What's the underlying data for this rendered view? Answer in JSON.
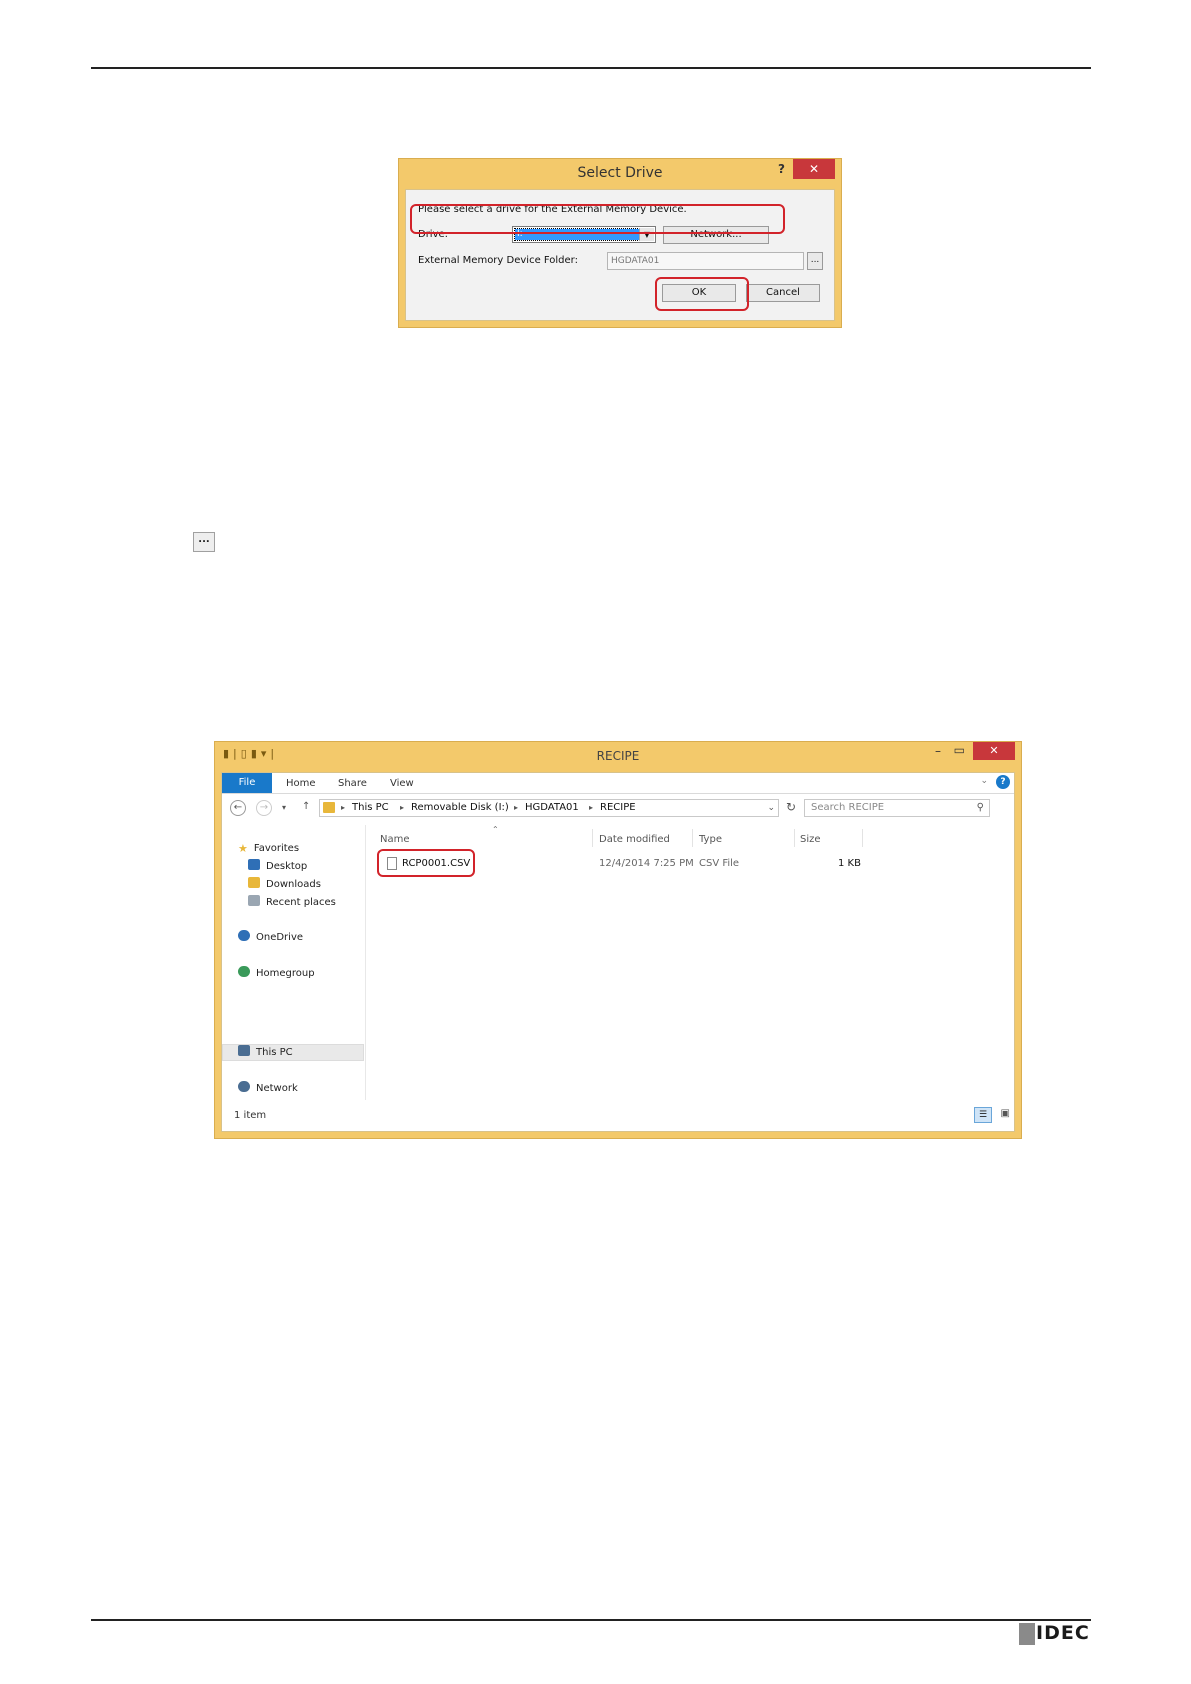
{
  "select_drive_dialog": {
    "title": "Select Drive",
    "help_glyph": "?",
    "close_glyph": "✕",
    "message": "Please select a drive for the External Memory Device.",
    "drive_label": "Drive:",
    "drive_value": "I:",
    "network_button": "Network...",
    "folder_label": "External Memory Device Folder:",
    "folder_value": "HGDATA01",
    "browse_button": "...",
    "ok_button": "OK",
    "cancel_button": "Cancel"
  },
  "standalone_browse_button": "...",
  "explorer": {
    "title": "RECIPE",
    "ribbon_tabs": {
      "file": "File",
      "home": "Home",
      "share": "Share",
      "view": "View"
    },
    "breadcrumb": [
      "This PC",
      "Removable Disk (I:)",
      "HGDATA01",
      "RECIPE"
    ],
    "search_placeholder": "Search RECIPE",
    "nav": {
      "favorites": "Favorites",
      "desktop": "Desktop",
      "downloads": "Downloads",
      "recent": "Recent places",
      "onedrive": "OneDrive",
      "homegroup": "Homegroup",
      "thispc": "This PC",
      "network": "Network"
    },
    "columns": {
      "name": "Name",
      "date": "Date modified",
      "type": "Type",
      "size": "Size"
    },
    "files": [
      {
        "name": "RCP0001.CSV",
        "date": "12/4/2014 7:25 PM",
        "type": "CSV File",
        "size": "1 KB"
      }
    ],
    "status": "1 item"
  },
  "logo_text": "IDEC",
  "colors": {
    "window_frame": "#f3c96b",
    "close_button": "#c8373b",
    "highlight": "#d2232a",
    "file_tab": "#1979ca"
  }
}
